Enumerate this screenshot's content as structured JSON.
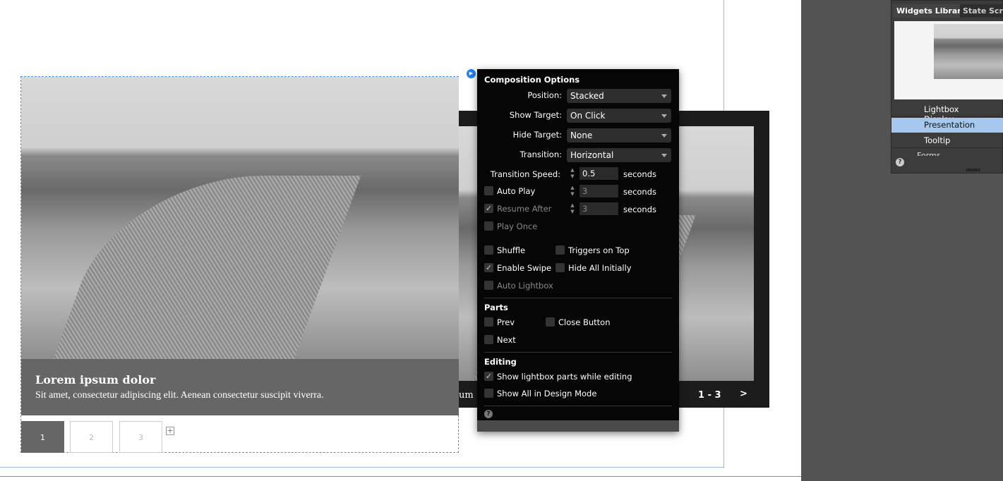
{
  "slideshow": {
    "caption_title": "Lorem ipsum dolor",
    "caption_text": "Sit amet, consectetur adipiscing elit. Aenean consectetur suscipit viverra.",
    "thumbs": [
      "1",
      "2",
      "3"
    ],
    "add_icon": "plus-icon",
    "behind_caption": "um",
    "counter": "1 - 3",
    "next": ">"
  },
  "popup": {
    "title": "Composition Options",
    "position_label": "Position:",
    "position_value": "Stacked",
    "show_label": "Show Target:",
    "show_value": "On Click",
    "hide_label": "Hide Target:",
    "hide_value": "None",
    "transition_label": "Transition:",
    "transition_value": "Horizontal",
    "speed_label": "Transition Speed:",
    "speed_value": "0.5",
    "seconds": "seconds",
    "autoplay": "Auto Play",
    "autoplay_value": "3",
    "resume": "Resume After",
    "resume_value": "3",
    "playonce": "Play Once",
    "shuffle": "Shuffle",
    "triggers": "Triggers on Top",
    "swipe": "Enable Swipe",
    "hideall": "Hide All Initially",
    "autolightbox": "Auto Lightbox",
    "parts": "Parts",
    "prev": "Prev",
    "close": "Close Button",
    "next": "Next",
    "editing": "Editing",
    "showparts": "Show lightbox parts while editing",
    "showall": "Show All in Design Mode"
  },
  "panel": {
    "tabs": [
      "Widgets Library",
      "States",
      "Scro"
    ],
    "items": [
      "Lightbox Display",
      "Presentation",
      "Tooltip",
      "Forms"
    ],
    "selected": "Presentation"
  },
  "colors": {
    "accent": "#a6c8ee",
    "panel": "#535353",
    "selection": "#4a90e2"
  }
}
